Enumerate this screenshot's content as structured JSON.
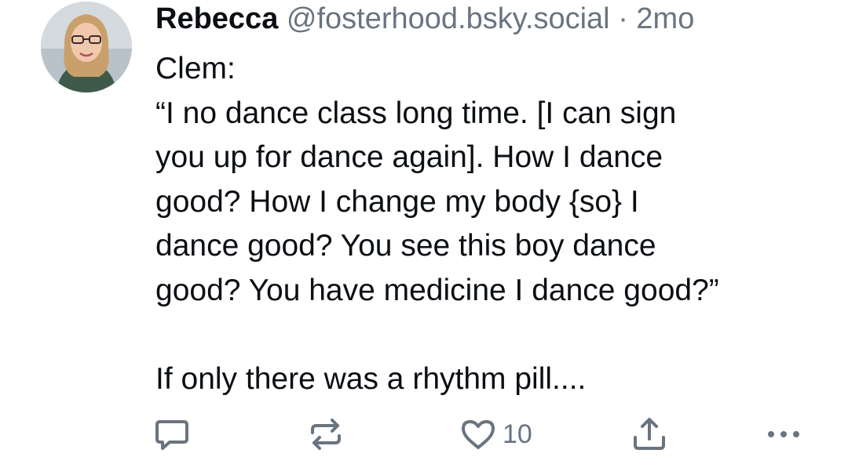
{
  "post": {
    "author_name": "Rebecca",
    "author_handle": "@fosterhood.bsky.social",
    "separator": "·",
    "timestamp": "2mo",
    "text_lines": [
      "Clem:",
      "“I no dance class long time. [I can sign",
      "you up for dance again]. How I dance",
      "good? How I change my body {so} I",
      "dance good? You see this boy dance",
      "good? You have medicine I dance good?”",
      "",
      "If only there was a rhythm pill...."
    ]
  },
  "actions": {
    "reply_icon": "reply-icon",
    "repost_icon": "repost-icon",
    "like_icon": "heart-icon",
    "like_count": "10",
    "share_icon": "share-icon",
    "more_icon": "more-icon"
  },
  "colors": {
    "text": "#0b0f14",
    "muted": "#6a7480"
  }
}
